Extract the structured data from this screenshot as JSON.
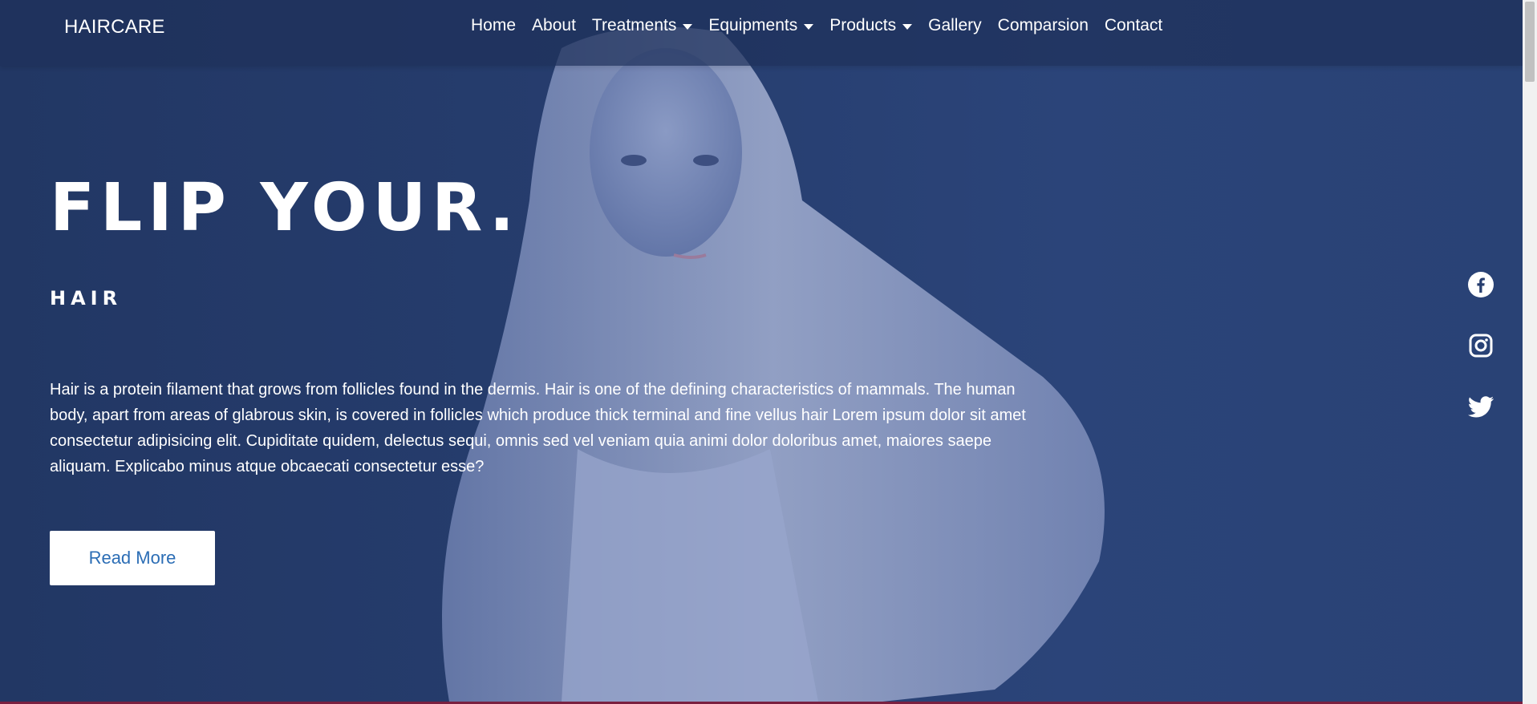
{
  "brand": "HAIRCARE",
  "nav": {
    "items": [
      {
        "label": "Home"
      },
      {
        "label": "About"
      },
      {
        "label": "Treatments"
      },
      {
        "label": "Equipments"
      },
      {
        "label": "Products"
      },
      {
        "label": "Gallery"
      },
      {
        "label": "Comparsion"
      },
      {
        "label": "Contact"
      }
    ]
  },
  "hero": {
    "title": "FLIP YOUR.",
    "subtitle": "HAIR",
    "description": "Hair is a protein filament that grows from follicles found in the dermis. Hair is one of the defining characteristics of mammals. The human body, apart from areas of glabrous skin, is covered in follicles which produce thick terminal and fine vellus hair Lorem ipsum dolor sit amet consectetur adipisicing elit. Cupiditate quidem, delectus sequi, omnis sed vel veniam quia animi dolor doloribus amet, maiores saepe aliquam. Explicabo minus atque obcaecati consectetur esse?",
    "button_label": "Read More"
  },
  "social": {
    "icons": [
      "facebook-icon",
      "instagram-icon",
      "twitter-icon"
    ]
  },
  "colors": {
    "overlay": "#263d6e",
    "button_text": "#2b6db5"
  }
}
